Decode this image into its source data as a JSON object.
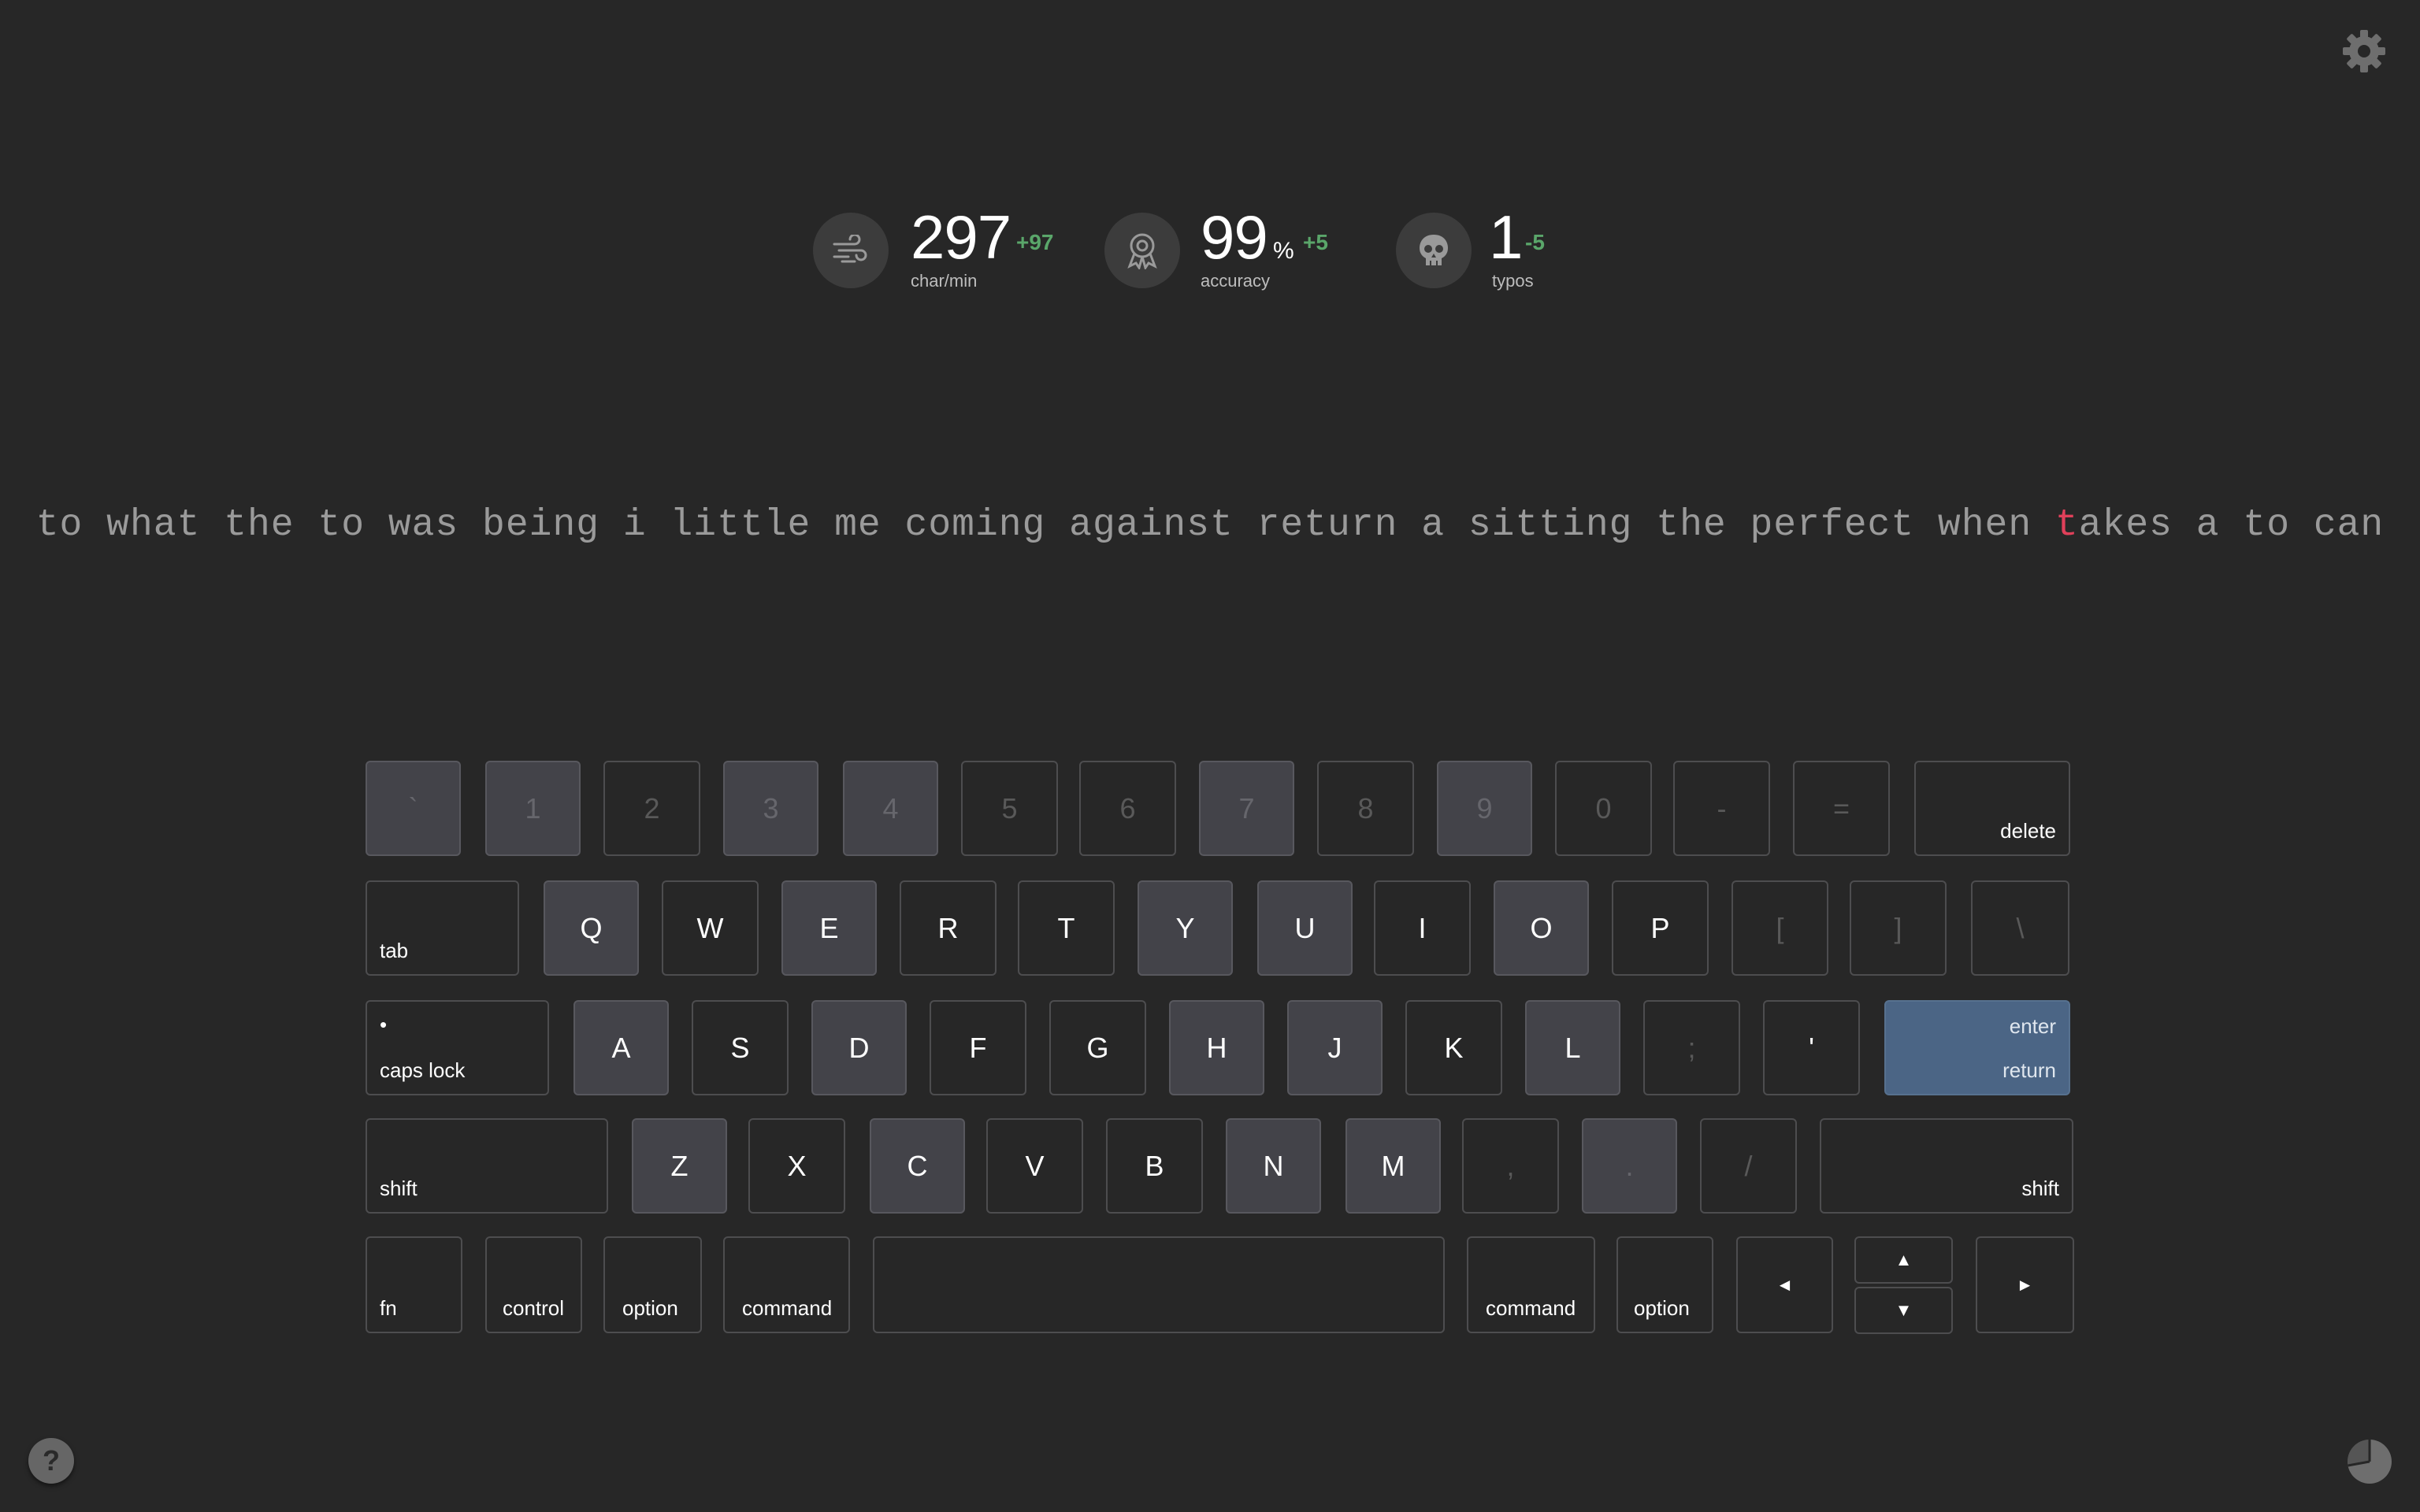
{
  "stats": {
    "speed": {
      "value": "297",
      "delta": "+97",
      "label": "char/min",
      "icon": "wind-icon"
    },
    "accuracy": {
      "value": "99",
      "unit": "%",
      "delta": "+5",
      "label": "accuracy",
      "icon": "award-icon"
    },
    "typos": {
      "value": "1",
      "delta": "-5",
      "label": "typos",
      "icon": "skull-icon"
    }
  },
  "lesson": {
    "before": "to what the to was being i little me coming against return a sitting the perfect when ",
    "current": "t",
    "after": "akes a to can"
  },
  "keyboard": {
    "row1": [
      "`",
      "1",
      "2",
      "3",
      "4",
      "5",
      "6",
      "7",
      "8",
      "9",
      "0",
      "-",
      "="
    ],
    "delete": "delete",
    "tab": "tab",
    "row2": [
      "Q",
      "W",
      "E",
      "R",
      "T",
      "Y",
      "U",
      "I",
      "O",
      "P",
      "[",
      "]",
      "\\"
    ],
    "caps_dot": "•",
    "caps": "caps lock",
    "row3": [
      "A",
      "S",
      "D",
      "F",
      "G",
      "H",
      "J",
      "K",
      "L",
      ";",
      "'"
    ],
    "enter": "enter",
    "return": "return",
    "shift_left": "shift",
    "row4": [
      "Z",
      "X",
      "C",
      "V",
      "B",
      "N",
      "M",
      ",",
      ".",
      "/"
    ],
    "shift_right": "shift",
    "fn": "fn",
    "control": "control",
    "option_left": "option",
    "command_left": "command",
    "command_right": "command",
    "option_right": "option",
    "arrow_left": "◄",
    "arrow_up": "▲",
    "arrow_down": "▼",
    "arrow_right": "►"
  },
  "colors": {
    "background": "#272727",
    "key_highlight": "#434349",
    "enter_key": "#4b6585",
    "current_char": "#e0405a",
    "delta_positive": "#5aa66a"
  },
  "help": "?"
}
